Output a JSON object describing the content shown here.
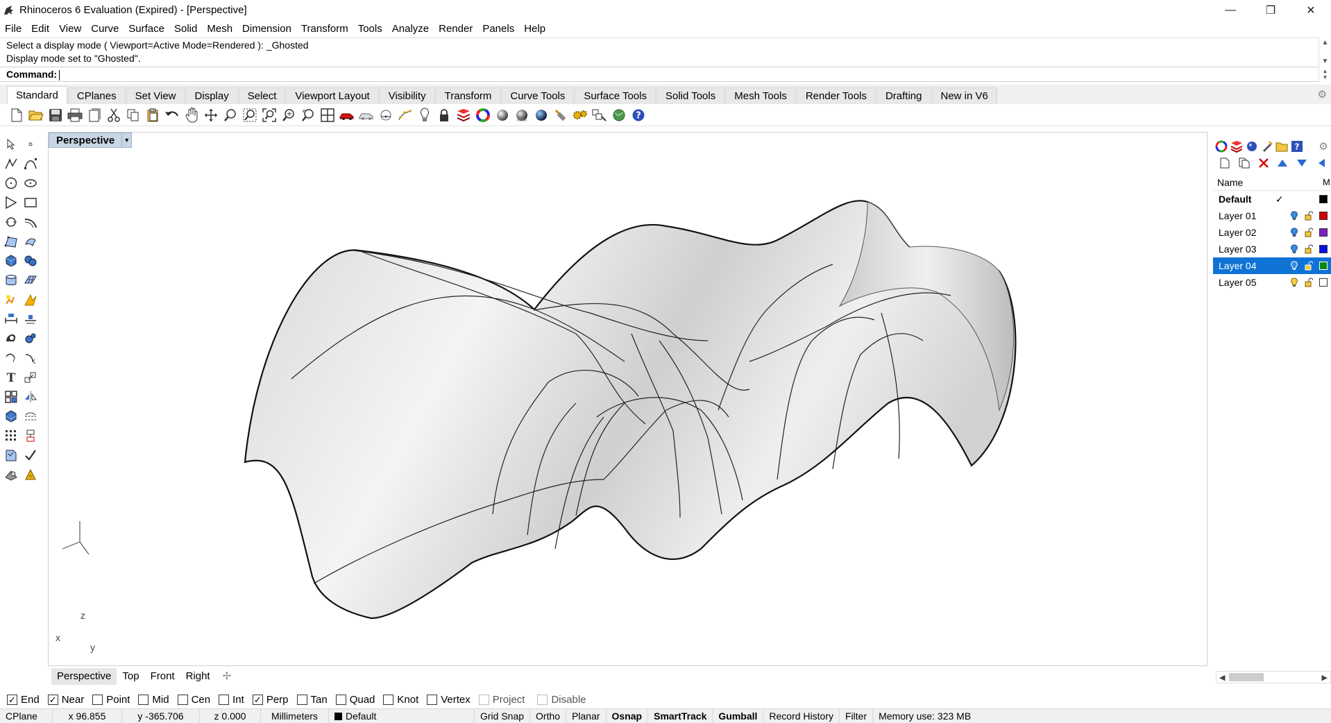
{
  "window": {
    "title": "Rhinoceros 6 Evaluation (Expired) - [Perspective]",
    "controls": [
      "—",
      "❐",
      "✕"
    ]
  },
  "menu": [
    "File",
    "Edit",
    "View",
    "Curve",
    "Surface",
    "Solid",
    "Mesh",
    "Dimension",
    "Transform",
    "Tools",
    "Analyze",
    "Render",
    "Panels",
    "Help"
  ],
  "command": {
    "history_line1": "Select a display mode ( Viewport=Active  Mode=Rendered ): _Ghosted",
    "history_line2": "Display mode set to \"Ghosted\".",
    "prompt": "Command:"
  },
  "toolbar_tabs": [
    "Standard",
    "CPlanes",
    "Set View",
    "Display",
    "Select",
    "Viewport Layout",
    "Visibility",
    "Transform",
    "Curve Tools",
    "Surface Tools",
    "Solid Tools",
    "Mesh Tools",
    "Render Tools",
    "Drafting",
    "New in V6"
  ],
  "active_tab": "Standard",
  "viewport": {
    "name": "Perspective",
    "axes": {
      "x": "x",
      "y": "y",
      "z": "z"
    }
  },
  "viewport_tabs": [
    "Perspective",
    "Top",
    "Front",
    "Right"
  ],
  "layers": {
    "header": "Name",
    "header_extra": "M",
    "rows": [
      {
        "name": "Default",
        "color": "#000000",
        "current": true
      },
      {
        "name": "Layer 01",
        "color": "#d40000"
      },
      {
        "name": "Layer 02",
        "color": "#7b1fc4"
      },
      {
        "name": "Layer 03",
        "color": "#0010e8"
      },
      {
        "name": "Layer 04",
        "color": "#0a8a0a",
        "selected": true
      },
      {
        "name": "Layer 05",
        "color": "#ffffff"
      }
    ]
  },
  "osnaps": [
    {
      "label": "End",
      "checked": true
    },
    {
      "label": "Near",
      "checked": true
    },
    {
      "label": "Point",
      "checked": false
    },
    {
      "label": "Mid",
      "checked": false
    },
    {
      "label": "Cen",
      "checked": false
    },
    {
      "label": "Int",
      "checked": false
    },
    {
      "label": "Perp",
      "checked": true
    },
    {
      "label": "Tan",
      "checked": false
    },
    {
      "label": "Quad",
      "checked": false
    },
    {
      "label": "Knot",
      "checked": false
    },
    {
      "label": "Vertex",
      "checked": false
    },
    {
      "label": "Project",
      "checked": false,
      "disabled": true
    },
    {
      "label": "Disable",
      "checked": false,
      "disabled": true
    }
  ],
  "status": {
    "cplane": "CPlane",
    "x": "x 96.855",
    "y": "y -365.706",
    "z": "z 0.000",
    "units": "Millimeters",
    "layer": "Default",
    "grid_snap": "Grid Snap",
    "ortho": "Ortho",
    "planar": "Planar",
    "osnap": "Osnap",
    "smarttrack": "SmartTrack",
    "gumball": "Gumball",
    "record_history": "Record History",
    "filter": "Filter",
    "memory": "Memory use: 323 MB"
  }
}
